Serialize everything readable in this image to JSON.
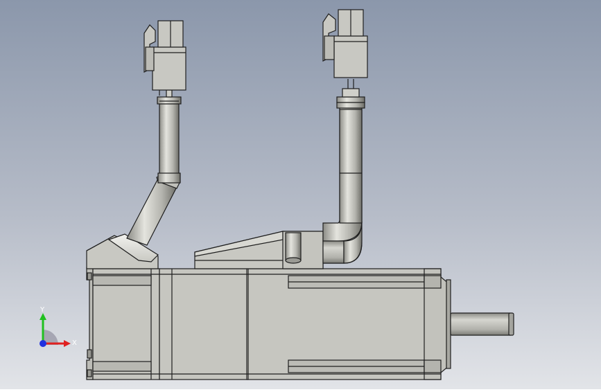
{
  "viewport": {
    "background_top": "#8e9aae",
    "background_bottom": "#dcdfe4",
    "body_color": "#c6c6c0",
    "edge_color": "#1e1e1e"
  },
  "model": {
    "parts": [
      "motor-body",
      "front-flange",
      "output-shaft",
      "rear-end-cap",
      "power-connector-housing",
      "encoder-connector-housing",
      "power-cable",
      "encoder-cable",
      "power-plug",
      "encoder-plug"
    ]
  },
  "triad": {
    "x_label": "X",
    "y_label": "Y",
    "x_color": "#e02020",
    "y_color": "#20c020",
    "z_color": "#2030e0"
  }
}
